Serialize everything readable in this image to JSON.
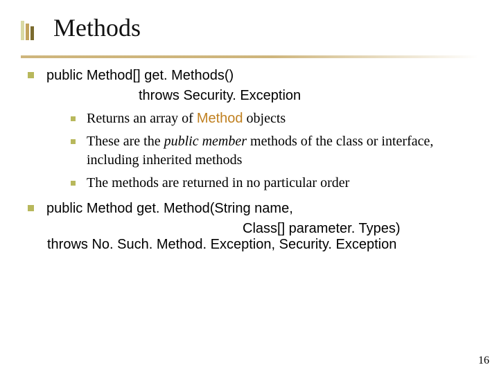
{
  "title": "Methods",
  "points": [
    {
      "line1_a": "public Method[] ",
      "line1_b": "get. Methods()",
      "line2_a": "throws ",
      "line2_b": "Security. Exception",
      "sub": [
        {
          "pre": "Returns an array of ",
          "orange": "Method",
          "post": " objects"
        },
        {
          "pre": "These are the ",
          "italic": "public member",
          "post": " methods of the class or interface, including inherited methods"
        },
        {
          "pre": "The methods are returned in no particular order",
          "italic": "",
          "post": ""
        }
      ]
    },
    {
      "line1": "public Method get. Method(String name,",
      "line2": "Class[] parameter. Types)",
      "line3": "throws No. Such. Method. Exception, Security. Exception"
    }
  ],
  "page_number": "16"
}
